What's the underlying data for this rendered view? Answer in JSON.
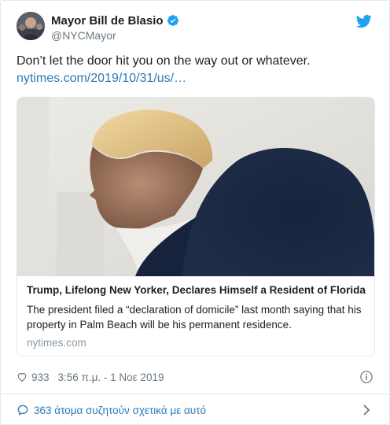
{
  "header": {
    "display_name": "Mayor Bill de Blasio",
    "handle": "@NYCMayor"
  },
  "tweet": {
    "text": "Don’t let the door hit you on the way out or whatever.",
    "link": "nytimes.com/2019/10/31/us/…"
  },
  "card": {
    "title": "Trump, Lifelong New Yorker, Declares Himself a Resident of Florida",
    "description": "The president filed a “declaration of domicile” last month saying that his property in Palm Beach will be his permanent residence.",
    "domain": "nytimes.com"
  },
  "meta": {
    "likes": "933",
    "timestamp": "3:56 π.μ. - 1 Νοε 2019"
  },
  "conversation": {
    "label": "363 άτομα συζητούν σχετικά με αυτό"
  },
  "icons": {
    "verified": "verified-badge-icon",
    "bird": "twitter-bird-icon",
    "heart": "heart-icon",
    "info": "info-icon",
    "bubble": "comment-bubble-icon",
    "chevron": "chevron-right-icon"
  },
  "colors": {
    "link": "#2b7bb9",
    "twitter_blue": "#1da1f2",
    "muted": "#697882",
    "border": "#e1e8ed"
  }
}
